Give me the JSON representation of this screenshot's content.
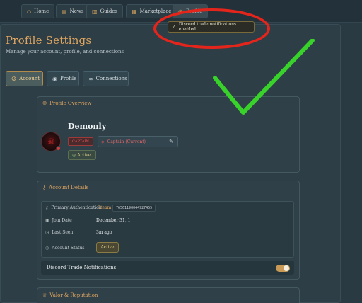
{
  "nav": {
    "items": [
      {
        "label": "Home",
        "icon": "home-icon",
        "glyph": "⌂"
      },
      {
        "label": "News",
        "icon": "news-icon",
        "glyph": "▤"
      },
      {
        "label": "Guides",
        "icon": "book-icon",
        "glyph": "▥"
      },
      {
        "label": "Marketplace",
        "icon": "shop-icon",
        "glyph": "▦"
      },
      {
        "label": "Profile",
        "icon": "user-icon",
        "glyph": "◉"
      }
    ]
  },
  "page": {
    "title": "Profile Settings",
    "subtitle": "Manage your account, profile, and connections"
  },
  "tabs": [
    {
      "label": "Account",
      "glyph": "☺",
      "active": true
    },
    {
      "label": "Profile",
      "glyph": "◉",
      "active": false
    },
    {
      "label": "Connections",
      "glyph": "∞",
      "active": false
    }
  ],
  "toast": {
    "message": "Discord trade notifications enabled",
    "glyph": "✓"
  },
  "profile_overview": {
    "title": "Profile Overview",
    "username": "Demonly",
    "badge": "CAPTAIN",
    "rank": "Captain (Current)",
    "status": "Active"
  },
  "account_details": {
    "title": "Account Details",
    "rows": [
      {
        "label": "Primary Authentication",
        "value": "Steam",
        "id": "76561190044927455"
      },
      {
        "label": "Join Date",
        "value": "December 31, 1"
      },
      {
        "label": "Last Seen",
        "value": "3m ago"
      },
      {
        "label": "Account Status",
        "value": "Active"
      }
    ],
    "discord_label": "Discord Trade Notifications",
    "discord_enabled": true
  },
  "valor": {
    "title": "Valor & Reputation"
  },
  "colors": {
    "accent": "#e0a55f",
    "background": "#2a3a42",
    "annotation_red": "#e3251c",
    "annotation_green": "#39d22a"
  }
}
